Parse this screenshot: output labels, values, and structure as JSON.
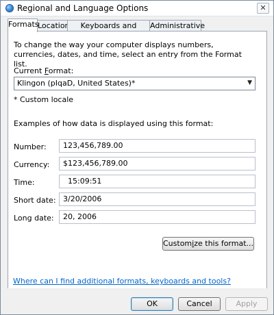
{
  "window": {
    "title": "Regional and Language Options",
    "close_glyph": "✕"
  },
  "tabs": [
    {
      "label": "Formats",
      "active": true
    },
    {
      "label": "Location",
      "active": false
    },
    {
      "label": "Keyboards and Languages",
      "active": false
    },
    {
      "label": "Administrative",
      "active": false
    }
  ],
  "formats": {
    "intro": "To change the way your computer displays numbers, currencies, dates, and time, select an entry from the Format list.",
    "current_format_label": {
      "before": "Current ",
      "accel": "F",
      "after": "ormat:"
    },
    "current_format_value": "Klingon (pIqaD, United States)*",
    "custom_note": "* Custom locale",
    "examples_heading": "Examples of how data is displayed using this format:",
    "examples": [
      {
        "label": "Number:",
        "value": "123,456,789.00"
      },
      {
        "label": "Currency:",
        "value": "$123,456,789.00"
      },
      {
        "label": "Time:",
        "value": "​ ﻿ 15:09:51"
      },
      {
        "label": "Short date:",
        "value": "3/20/2006"
      },
      {
        "label": "Long date:",
        "value": "20, 2006"
      }
    ],
    "customize_button": {
      "before": "Custom",
      "accel": "i",
      "after": "ze this format..."
    },
    "help_link": "Where can I find additional formats, keyboards and tools?"
  },
  "buttons": {
    "ok": "OK",
    "cancel": "Cancel",
    "apply": "Apply"
  },
  "colors": {
    "link": "#0066cc",
    "default_button_border": "#3c7fb1",
    "disabled_text": "#a0a0a0"
  }
}
